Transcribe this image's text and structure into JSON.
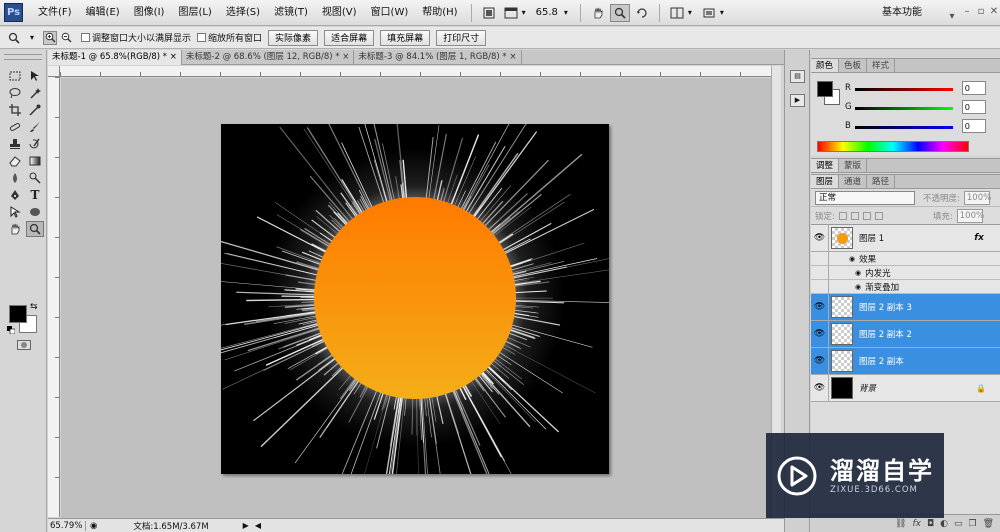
{
  "app": {
    "logo": "Ps"
  },
  "menubar": {
    "items": [
      "文件(F)",
      "编辑(E)",
      "图像(I)",
      "图层(L)",
      "选择(S)",
      "滤镜(T)",
      "视图(V)",
      "窗口(W)",
      "帮助(H)"
    ],
    "zoom": "65.8",
    "workspace": "基本功能"
  },
  "options": {
    "resize_windows": "调整窗口大小以满屏显示",
    "zoom_all": "缩放所有窗口",
    "actual_pixels": "实际像素",
    "fit_screen": "适合屏幕",
    "fill_screen": "填充屏幕",
    "print_size": "打印尺寸"
  },
  "documents": {
    "tabs": [
      "未标题-1 @ 65.8%(RGB/8) *",
      "未标题-2 @ 68.6% (图层 12, RGB/8) *",
      "未标题-3 @ 84.1% (图层 1, RGB/8) *"
    ]
  },
  "status": {
    "zoom": "65.79%",
    "doc": "文档:1.65M/3.67M"
  },
  "color_panel": {
    "tabs": [
      "颜色",
      "色板",
      "样式"
    ],
    "r_label": "R",
    "g_label": "G",
    "b_label": "B",
    "r": "0",
    "g": "0",
    "b": "0"
  },
  "adjust_panel": {
    "tabs": [
      "调整",
      "蒙版"
    ]
  },
  "layers_panel": {
    "tabs": [
      "图层",
      "通道",
      "路径"
    ],
    "blend_mode": "正常",
    "opacity_label": "不透明度:",
    "opacity": "100%",
    "lock_label": "锁定:",
    "fill_label": "填充:",
    "fill": "100%",
    "layers": [
      {
        "name": "图层 1",
        "fx": "fx"
      },
      {
        "name": "图层 2 副本 3"
      },
      {
        "name": "图层 2 副本 2"
      },
      {
        "name": "图层 2 副本"
      },
      {
        "name": "背景"
      }
    ],
    "effects_label": "效果",
    "effects": [
      "内发光",
      "渐变叠加"
    ]
  },
  "watermark": {
    "title": "溜溜自学",
    "url": "ZIXUE.3D66.COM"
  },
  "colors": {
    "sun_top": "#ff7a00",
    "sun_bottom": "#f4ae18",
    "selected_layer": "#3b8fe0"
  }
}
